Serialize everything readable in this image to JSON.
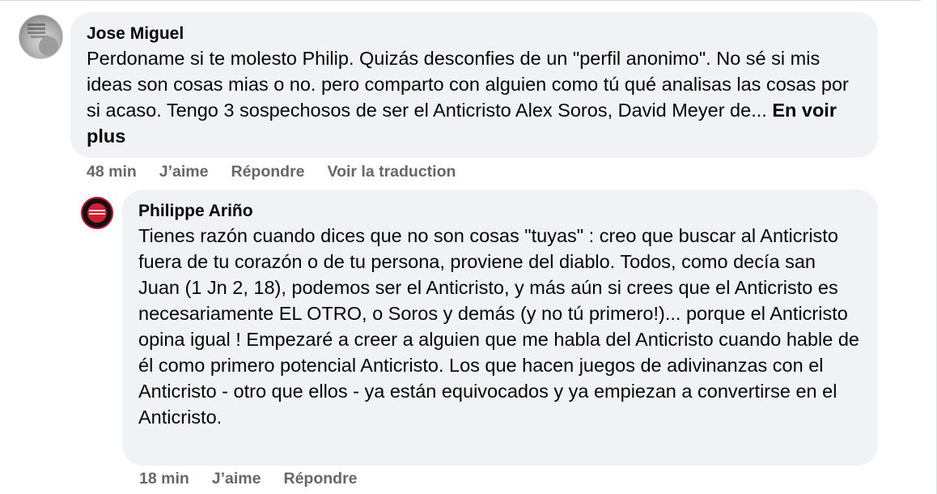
{
  "comments": [
    {
      "author": "Jose Miguel",
      "text": "Perdoname si te molesto Philip. Quizás desconfies de un \"perfil anonimo\". No sé si mis ideas son cosas mias o no. pero comparto con alguien como tú qué analisas las cosas por si acaso. Tengo 3 sospechosos de ser el Anticristo Alex Soros, David Meyer de... ",
      "see_more": "En voir plus",
      "time": "48 min",
      "like": "J’aime",
      "reply": "Répondre",
      "translate": "Voir la traduction",
      "avatar_icon": "profile-photo-gray"
    },
    {
      "author": "Philippe Ariño",
      "text": "Tienes razón cuando dices que no son cosas \"tuyas\" : creo que buscar al Anticristo fuera de tu corazón o de tu persona, proviene del diablo. Todos, como decía san Juan (1 Jn 2, 18), podemos ser el Anticristo, y más aún si crees que el Anticristo es necesariamente EL OTRO, o Soros y demás (y no tú primero!)... porque el Anticristo opina igual ! Empezaré a creer a alguien que me habla del Anticristo cuando hable de él como primero potencial Anticristo. Los que hacen juegos de adivinanzas con el Anticristo - otro que ellos - ya están equivocados y ya empiezan a convertirse en el Anticristo.",
      "time": "18 min",
      "like": "J’aime",
      "reply": "Répondre",
      "avatar_icon": "profile-photo-red-black-logo"
    }
  ],
  "colors": {
    "bubble_bg": "#f0f2f5",
    "text": "#050505",
    "meta_text": "#65676b"
  }
}
